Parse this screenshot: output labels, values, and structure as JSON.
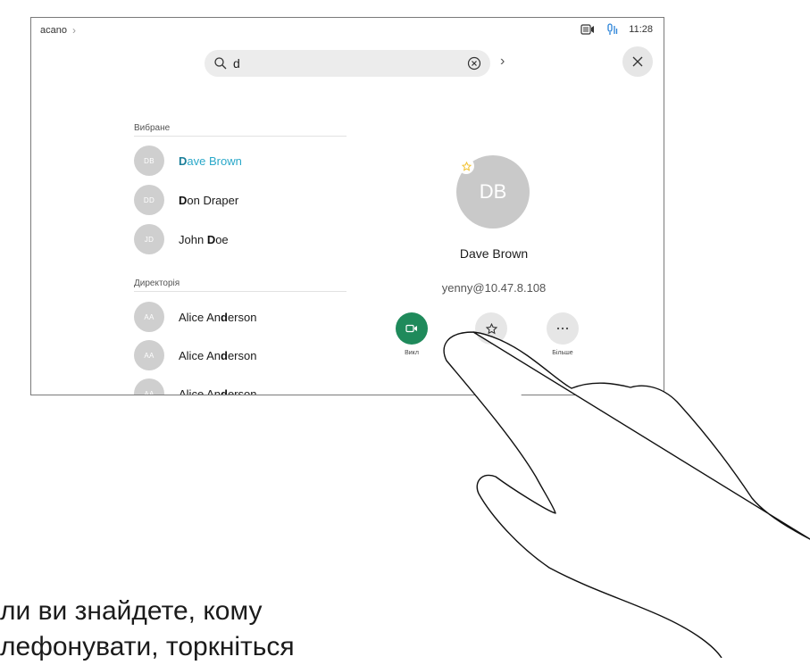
{
  "status": {
    "device": "acano",
    "time": "11:28",
    "icons": [
      "screen-share-icon",
      "microphone-icon"
    ]
  },
  "search": {
    "query": "d",
    "icons": [
      "search-icon",
      "clear-icon",
      "chevron-right-icon"
    ]
  },
  "favorites": {
    "title": "Вибране",
    "items": [
      {
        "initials": "DB",
        "match": "D",
        "rest": "ave Brown",
        "selected": true
      },
      {
        "initials": "DD",
        "match": "D",
        "rest": "on Draper",
        "selected": false
      },
      {
        "initials": "JD",
        "pre": "John ",
        "match": "D",
        "rest": "oe",
        "selected": false
      }
    ]
  },
  "directory": {
    "title": "Директорія",
    "items": [
      {
        "initials": "AA",
        "pre": "Alice An",
        "match": "d",
        "rest": "erson"
      },
      {
        "initials": "AA",
        "pre": "Alice An",
        "match": "d",
        "rest": "erson"
      },
      {
        "initials": "AA",
        "pre": "Alice An",
        "match": "d",
        "rest": "erson"
      }
    ]
  },
  "contact": {
    "initials": "DB",
    "name": "Dave Brown",
    "address": "yenny@10.47.8.108",
    "actions": {
      "call_label": "Викл",
      "favorite_label": "",
      "more_label": "Більше"
    }
  },
  "caption": {
    "line1": "ли ви знайдете, кому",
    "line2": "лефонувати, торкніться"
  },
  "colors": {
    "call": "#1f8a5b",
    "selected": "#2aa8c9",
    "avatar": "#cfcfcf",
    "favorite_star": "#f2c12e"
  }
}
